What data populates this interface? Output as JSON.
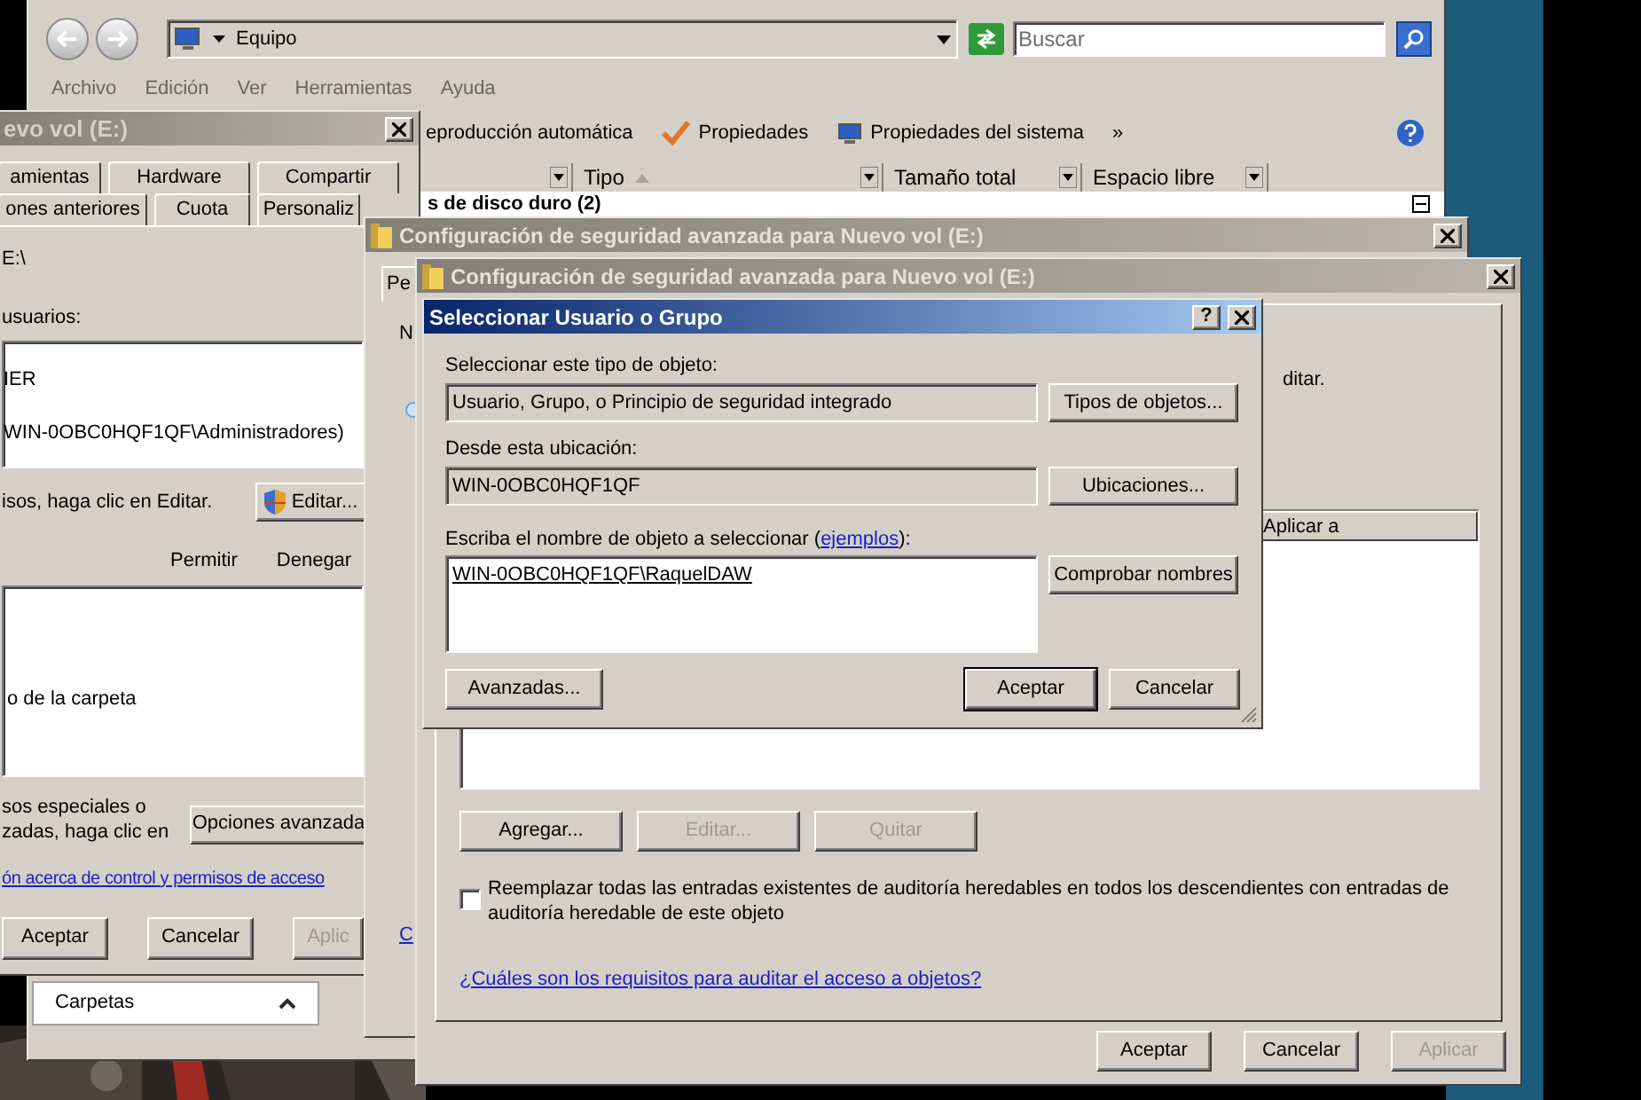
{
  "explorer": {
    "address": "Equipo",
    "search": {
      "placeholder": "Buscar"
    },
    "menu": [
      "Archivo",
      "Edición",
      "Ver",
      "Herramientas",
      "Ayuda"
    ],
    "toolbar": [
      {
        "kind": "text",
        "label": "eproducción automática"
      },
      {
        "kind": "check",
        "label": "Propiedades"
      },
      {
        "kind": "monitor",
        "label": "Propiedades del sistema"
      },
      {
        "kind": "text",
        "label": "»"
      }
    ],
    "columns": [
      "Tipo",
      "Tamaño total",
      "Espacio libre"
    ],
    "group_header": "s de disco duro (2)"
  },
  "properties_window": {
    "title": "evo vol (E:)",
    "tab_rows": [
      [
        "amientas",
        "Hardware",
        "Compartir"
      ],
      [
        "ones anteriores",
        "Cuota",
        "Personaliz"
      ]
    ],
    "path": "E:\\",
    "users_label": "usuarios:",
    "users": [
      "IER",
      "WIN-0OBC0HQF1QF\\Administradores)"
    ],
    "edit_hint": "isos, haga clic en Editar.",
    "edit_button": "Editar...",
    "permission_columns": [
      "Permitir",
      "Denegar"
    ],
    "permissions": [
      "o de la carpeta"
    ],
    "special_lines": [
      "sos especiales o",
      "zadas, haga clic en"
    ],
    "advanced_button": "Opciones avanzada",
    "help_link": "ón acerca de control y permisos de acceso",
    "buttons": [
      {
        "label": "Aceptar",
        "disabled": false
      },
      {
        "label": "Cancelar",
        "disabled": false
      },
      {
        "label": "Aplic",
        "disabled": true
      }
    ]
  },
  "folders_pane": {
    "label": "Carpetas"
  },
  "security_window_back": {
    "title": "Configuración de seguridad avanzada para Nuevo vol (E:)",
    "tab": "Pe",
    "label": "N",
    "link": "C"
  },
  "security_window": {
    "title": "Configuración de seguridad avanzada para Nuevo vol (E:)",
    "hint": "ditar.",
    "columns": [
      "Aplicar a"
    ],
    "buttons": [
      {
        "label": "Agregar...",
        "disabled": false
      },
      {
        "label": "Editar...",
        "disabled": true
      },
      {
        "label": "Quitar",
        "disabled": true
      }
    ],
    "replace": {
      "checked": false,
      "label": "Reemplazar todas las entradas existentes de auditoría heredables en todos los descendientes con entradas de auditoría heredable de este objeto"
    },
    "link": "¿Cuáles son los requisitos para auditar el acceso a objetos?",
    "footer_buttons": [
      {
        "label": "Aceptar",
        "disabled": false
      },
      {
        "label": "Cancelar",
        "disabled": false
      },
      {
        "label": "Aplicar",
        "disabled": true
      }
    ]
  },
  "dialog": {
    "title": "Seleccionar Usuario o Grupo",
    "help_button": "?",
    "object_type": {
      "label": "Seleccionar este tipo de objeto:",
      "value": "Usuario, Grupo, o Principio de seguridad integrado",
      "button": "Tipos de objetos..."
    },
    "location": {
      "label": "Desde esta ubicación:",
      "value": "WIN-0OBC0HQF1QF",
      "button": "Ubicaciones..."
    },
    "names": {
      "label_start": "Escriba el nombre de objeto a seleccionar (",
      "link": "ejemplos",
      "label_end": "):",
      "value": "WIN-0OBC0HQF1QF\\RaquelDAW",
      "button": "Comprobar nombres"
    },
    "buttons": [
      {
        "label": "Avanzadas...",
        "default": false
      },
      {
        "label": "Aceptar",
        "default": true
      },
      {
        "label": "Cancelar",
        "default": false
      }
    ]
  }
}
